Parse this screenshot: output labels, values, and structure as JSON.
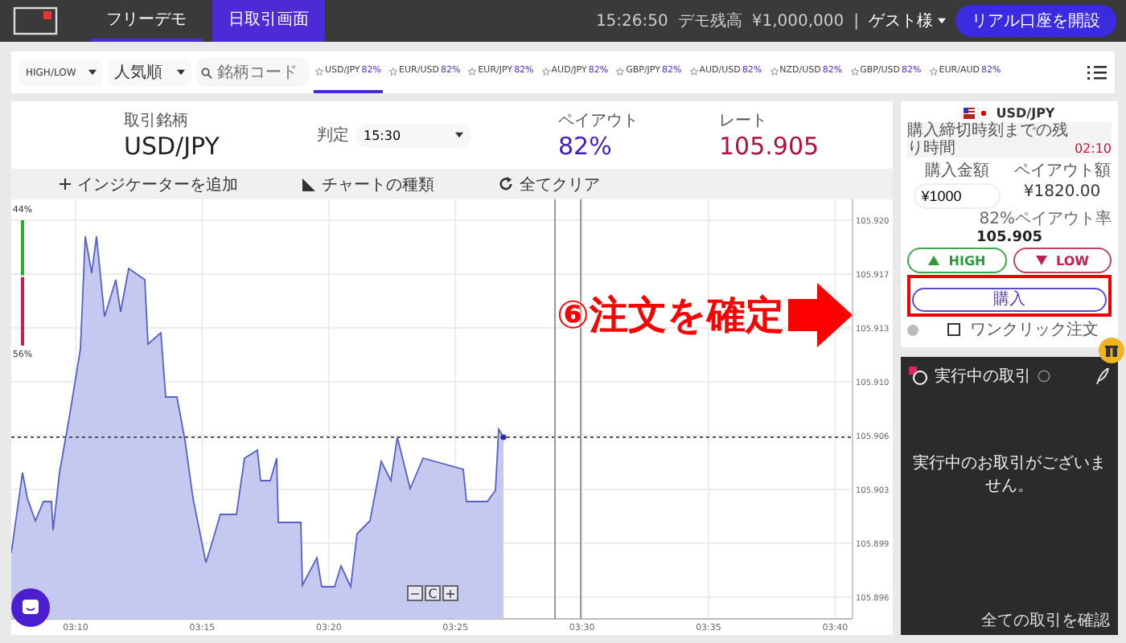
{
  "topbar": {
    "tabs": [
      {
        "label": "フリーデモ",
        "selected": false
      },
      {
        "label": "日取引画面",
        "selected": true
      }
    ],
    "time": "15:26:50",
    "balance_label": "デモ残高",
    "balance": "¥1,000,000",
    "separator": "|",
    "user": "ゲスト様",
    "open_account_button": "リアル口座を開設"
  },
  "filters": {
    "type": "HIGH/LOW",
    "sort": "人気順"
  },
  "search": {
    "placeholder": "銘柄コード"
  },
  "pairs": [
    {
      "name": "USD/JPY",
      "payout": "82%",
      "selected": true
    },
    {
      "name": "EUR/USD",
      "payout": "82%",
      "selected": false
    },
    {
      "name": "EUR/JPY",
      "payout": "82%",
      "selected": false
    },
    {
      "name": "AUD/JPY",
      "payout": "82%",
      "selected": false
    },
    {
      "name": "GBP/JPY",
      "payout": "82%",
      "selected": false
    },
    {
      "name": "AUD/USD",
      "payout": "82%",
      "selected": false
    },
    {
      "name": "NZD/USD",
      "payout": "82%",
      "selected": false
    },
    {
      "name": "GBP/USD",
      "payout": "82%",
      "selected": false
    },
    {
      "name": "EUR/AUD",
      "payout": "82%",
      "selected": false
    }
  ],
  "summary": {
    "symbol_label": "取引銘柄",
    "symbol": "USD/JPY",
    "expiry_label": "判定",
    "expiry": "15:30",
    "payout_label": "ペイアウト",
    "payout": "82%",
    "rate_label": "レート",
    "rate": "105.905"
  },
  "toolbar": [
    {
      "kind": "add",
      "label": "インジケーターを追加"
    },
    {
      "kind": "chart",
      "label": "チャートの種類"
    },
    {
      "kind": "clear",
      "label": "全てクリア"
    }
  ],
  "chart": {
    "y_labels": [
      "105.920",
      "105.917",
      "105.913",
      "105.910",
      "105.906",
      "105.903",
      "105.899",
      "105.896"
    ],
    "x_labels": [
      "03:10",
      "03:15",
      "03:20",
      "03:25",
      "03:30",
      "03:35",
      "03:40"
    ],
    "sentiment": {
      "high": "44%",
      "low": "56%",
      "level": 0.44
    },
    "zoom_buttons": [
      "−",
      "C",
      "+"
    ]
  },
  "order": {
    "symbol": "USD/JPY",
    "deadline_label": "購入締切時刻までの残り時間",
    "deadline": "02:10",
    "amount_label": "購入金額",
    "payout_label": "ペイアウト額",
    "amount": "¥1000",
    "payout": "¥1820.00",
    "payout_rate": "82%ペイアウト率",
    "rate": "105.905",
    "high_button": "HIGH",
    "low_button": "LOW",
    "buy_button": "購入",
    "one_click": {
      "label": "ワンクリック注文",
      "checked": false
    }
  },
  "positions": {
    "title": "実行中の取引",
    "empty": "実行中のお取引がございません。",
    "link": "全ての取引を確認"
  },
  "annotation": {
    "text": "⑥注文を確定"
  }
}
